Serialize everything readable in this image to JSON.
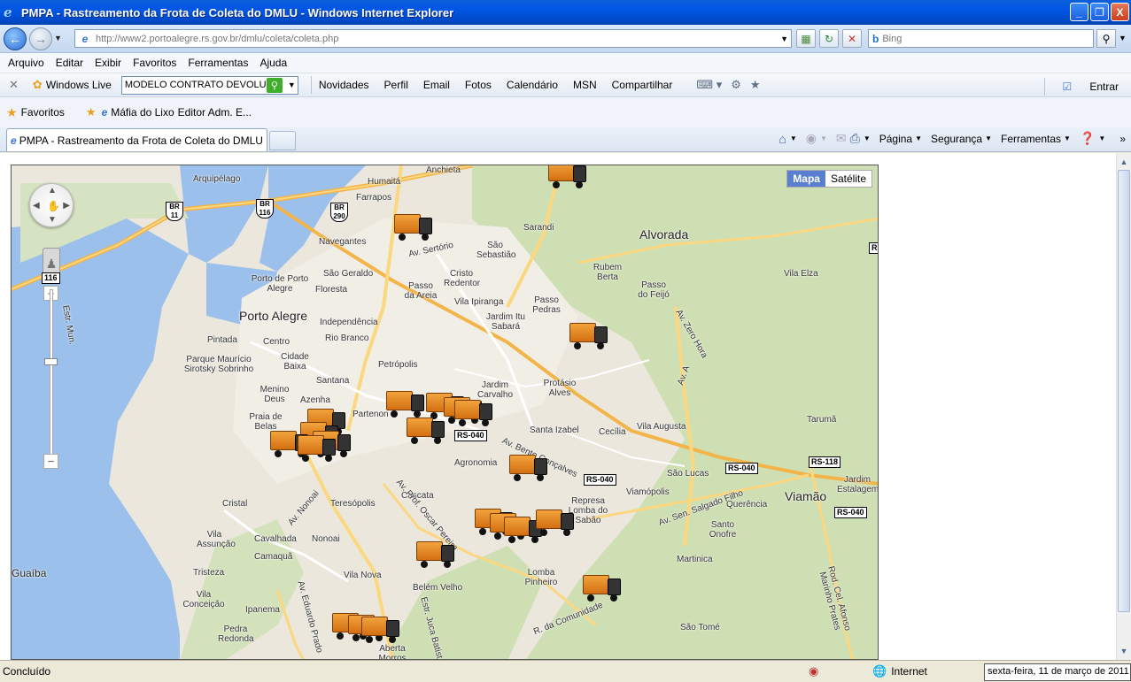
{
  "window": {
    "title": "PMPA - Rastreamento da Frota de Coleta do DMLU - Windows Internet Explorer",
    "min": "_",
    "max": "❐",
    "close": "X"
  },
  "address": {
    "url": "http://www2.portoalegre.rs.gov.br/dmlu/coleta/coleta.php",
    "search_placeholder": "Bing"
  },
  "menu": [
    "Arquivo",
    "Editar",
    "Exibir",
    "Favoritos",
    "Ferramentas",
    "Ajuda"
  ],
  "wl_toolbar": {
    "brand": "Windows Live",
    "search_value": "MODELO CONTRATO DEVOLUÇÃ",
    "links": [
      "Novidades",
      "Perfil",
      "Email",
      "Fotos",
      "Calendário",
      "MSN",
      "Compartilhar"
    ],
    "signin": "Entrar"
  },
  "favorites": {
    "label": "Favoritos",
    "links": [
      "Máfia do Lixo",
      "Editor Adm. E..."
    ]
  },
  "tab": {
    "title": "PMPA - Rastreamento da Frota de Coleta do DMLU"
  },
  "command_bar": {
    "page": "Página",
    "security": "Segurança",
    "tools": "Ferramentas"
  },
  "map": {
    "type_buttons": [
      "Mapa",
      "Satélite"
    ],
    "active_type": "Mapa",
    "cities": [
      "Porto Alegre",
      "Alvorada",
      "Viamão"
    ],
    "places": [
      "Arquipélago",
      "Humaitá",
      "Farrapos",
      "Navegantes",
      "São Geraldo",
      "Floresta",
      "Porto de Porto Alegre",
      "Independência",
      "Rio Branco",
      "Centro",
      "Pintada",
      "Cidade Baixa",
      "Parque Maurício Sirotsky Sobrinho",
      "Santana",
      "Menino Deus",
      "Azenha",
      "Praia de Belas",
      "Partenon",
      "Petrópolis",
      "Jardim Carvalho",
      "Protásio Alves",
      "Santa Izabel",
      "Cecília",
      "Vila Augusta",
      "Agronomia",
      "Cascata",
      "Teresópolis",
      "Cristal",
      "Vila Assunção",
      "Cavalhada",
      "Nonoai",
      "Camaquã",
      "Tristeza",
      "Vila Nova",
      "Belém Velho",
      "Vila Conceição",
      "Ipanema",
      "Pedra Redonda",
      "Aberta Morros",
      "Lomba Pinheiro",
      "Viamópolis",
      "Represa Lomba do Sabão",
      "São Lucas",
      "Santo Onofre",
      "Martinica",
      "São Tomé",
      "Querência",
      "Jardim Estalagem",
      "Tarumã",
      "Vila Elza",
      "Passo do Feijó",
      "Rubem Berta",
      "Passo Pedras",
      "Jardim Itu Sabará",
      "Vila Ipiranga",
      "Cristo Redentor",
      "Passo da Areia",
      "São Sebastião",
      "Sarandi",
      "Guaíba",
      "Anchieta"
    ],
    "roads": [
      "Av. Sertório",
      "Av. Zero Hora",
      "Av. A",
      "Av. Nonoai",
      "Av. Prof. Oscar Pereira",
      "Av. Eduardo Prado",
      "Estr. Juca Batista",
      "R. da Comunidade",
      "Av. Sen. Salgado Filho",
      "Rod. Cel. Afonso Marinho Prates",
      "Av. Bento Gonçalves",
      "Estr. Mun."
    ],
    "shields": [
      "BR 11",
      "BR 116",
      "BR 290",
      "RS-040",
      "RS-040",
      "RS-040",
      "RS-040",
      "RS-118",
      "116",
      "RS"
    ],
    "truck_count": 23
  },
  "status": {
    "text": "Concluído",
    "zone": "Internet",
    "clock": "sexta-feira, 11 de março de 2011"
  }
}
